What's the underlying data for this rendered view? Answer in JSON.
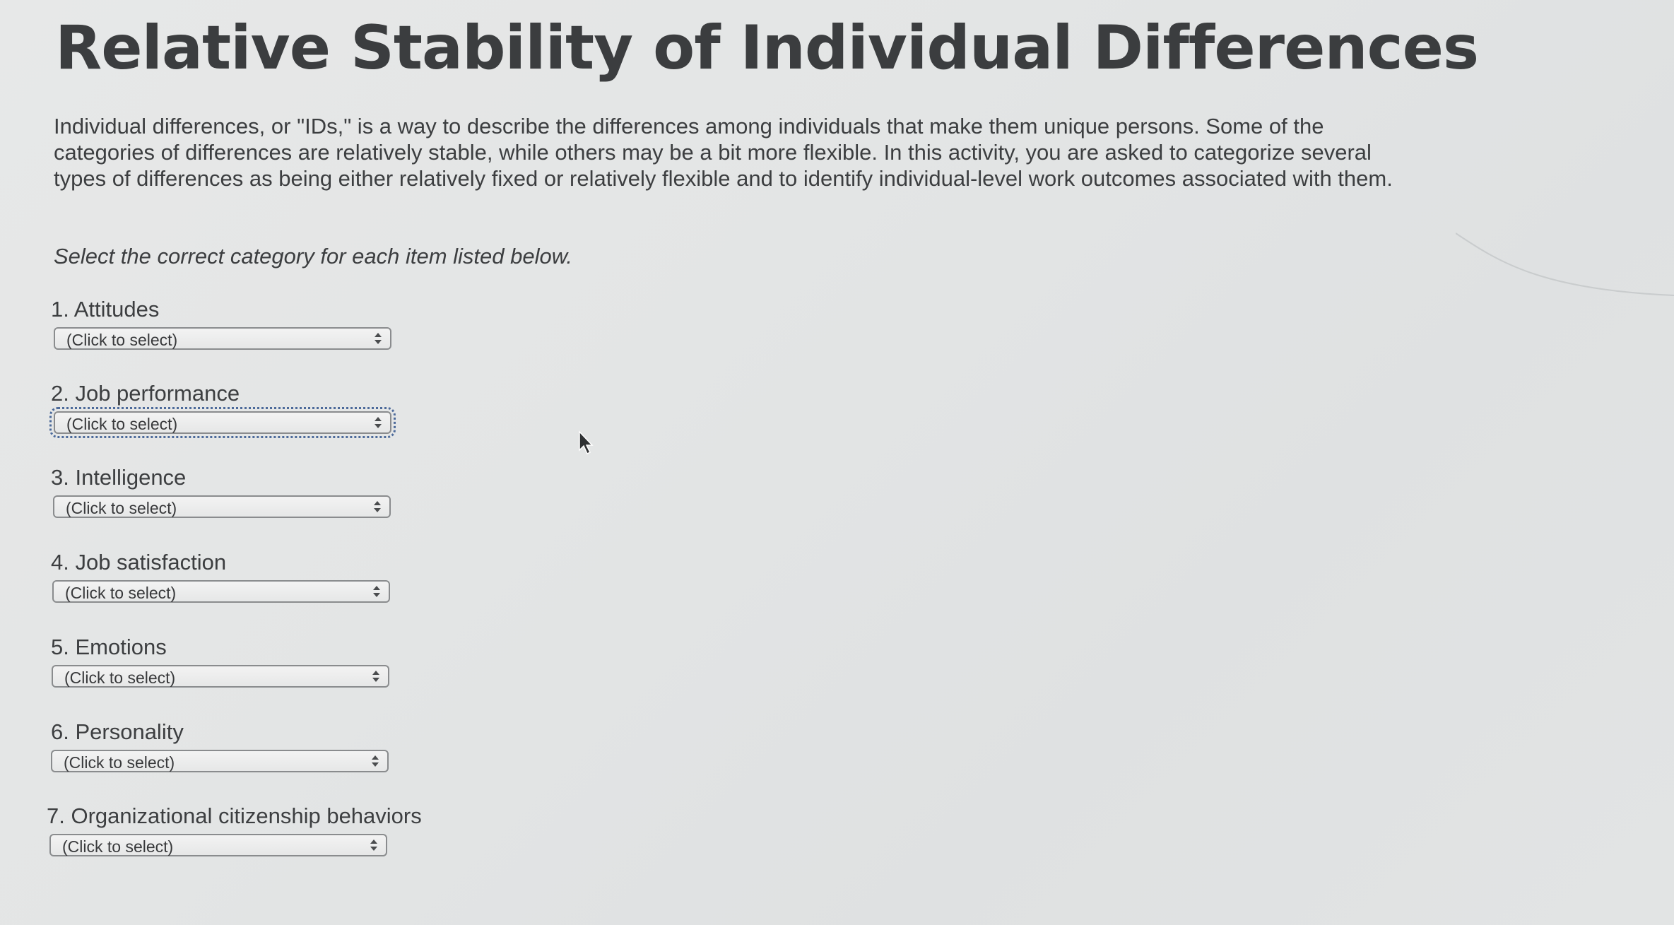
{
  "page": {
    "title": "Relative Stability of Individual Differences",
    "intro": "Individual differences, or \"IDs,\" is a way to describe the differences among individuals that make them unique persons. Some of the categories of differences are relatively stable, while others may be a bit more flexible. In this activity, you are asked to categorize several types of differences as being either relatively fixed or relatively flexible and to identify individual-level work outcomes associated with them.",
    "instruction": "Select the correct category for each item listed below."
  },
  "items": [
    {
      "label": "1. Attitudes",
      "selected": "(Click to select)"
    },
    {
      "label": "2. Job performance",
      "selected": "(Click to select)"
    },
    {
      "label": "3. Intelligence",
      "selected": "(Click to select)"
    },
    {
      "label": "4. Job satisfaction",
      "selected": "(Click to select)"
    },
    {
      "label": "5. Emotions",
      "selected": "(Click to select)"
    },
    {
      "label": "6. Personality",
      "selected": "(Click to select)"
    },
    {
      "label": "7. Organizational citizenship behaviors",
      "selected": "(Click to select)"
    }
  ],
  "icons": {
    "select_arrows": "up-down-arrows-icon",
    "cursor": "mouse-pointer-icon"
  },
  "colors": {
    "text": "#3c3e40",
    "focus_outline": "#4c6a9a"
  }
}
